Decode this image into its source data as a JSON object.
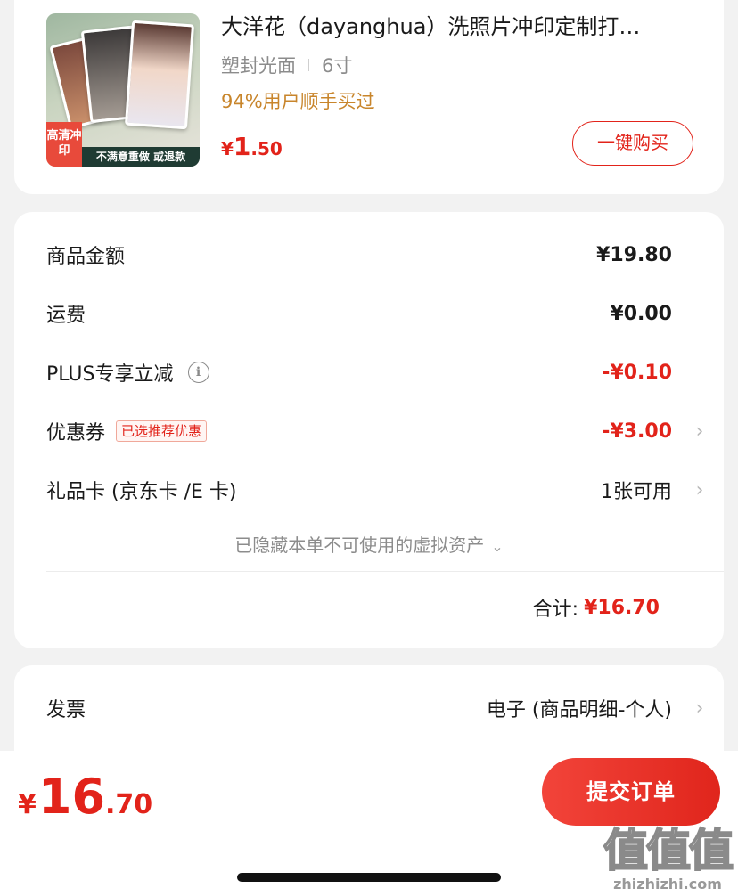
{
  "product": {
    "title": "大洋花（dayanghua）洗照片冲印定制打…",
    "spec_finish": "塑封光面",
    "spec_size": "6寸",
    "social_proof": "94%用户顺手买过",
    "price_currency": "¥",
    "price_int": "1",
    "price_dec": ".50",
    "buy_button": "一键购买",
    "thumb_badge": "高清冲印",
    "thumb_banner": "不满意重做 或退款"
  },
  "summary": {
    "goods_amount_label": "商品金额",
    "goods_amount_value": "¥19.80",
    "shipping_label": "运费",
    "shipping_value": "¥0.00",
    "plus_label": "PLUS专享立减",
    "plus_value": "-¥0.10",
    "coupon_label": "优惠券",
    "coupon_tag": "已选推荐优惠",
    "coupon_value": "-¥3.00",
    "giftcard_label": "礼品卡 (京东卡 /E 卡)",
    "giftcard_value": "1张可用",
    "hidden_assets": "已隐藏本单不可使用的虚拟资产",
    "total_label": "合计:",
    "total_value": "¥16.70"
  },
  "invoice": {
    "label": "发票",
    "value": "电子 (商品明细-个人)"
  },
  "bottom": {
    "price_currency": "¥",
    "price_int": "16",
    "price_dec": ".70",
    "submit_button": "提交订单"
  },
  "watermark": {
    "glyphs": "值值值",
    "url": "zhizhizhi.com"
  },
  "colors": {
    "accent_red": "#e2231a",
    "social_orange": "#c8852b",
    "background": "#f2f2f2"
  }
}
